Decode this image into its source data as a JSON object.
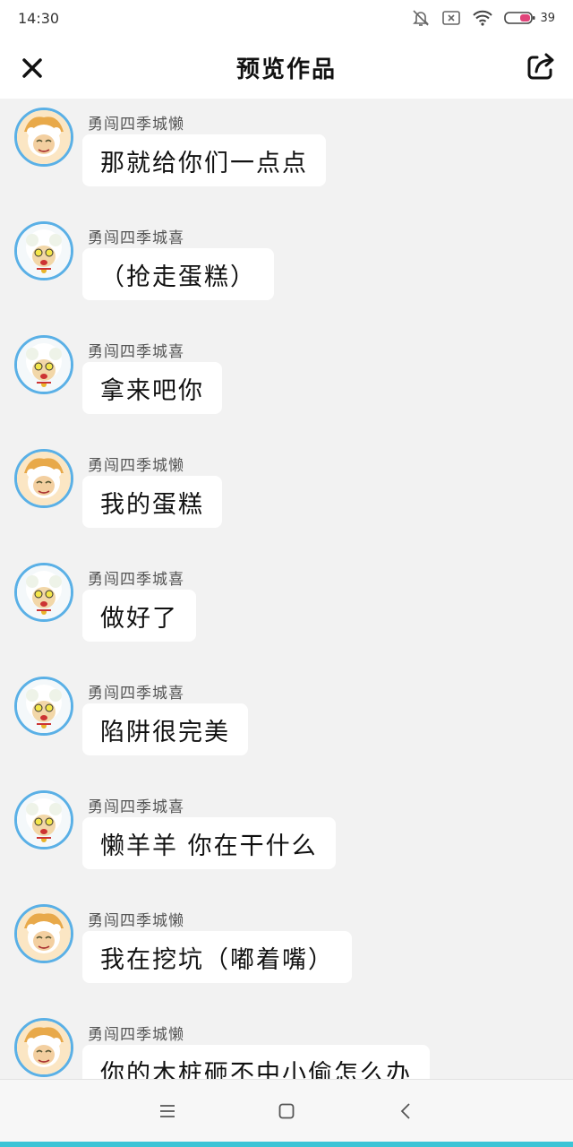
{
  "status_bar": {
    "time": "14:30",
    "battery": "39",
    "icons": [
      "bell-muted-icon",
      "sim-off-icon",
      "wifi-icon",
      "battery-icon"
    ]
  },
  "header": {
    "title": "预览作品",
    "close_icon": "close-icon",
    "share_icon": "share-icon"
  },
  "messages": [
    {
      "sender": "勇闯四季城懒",
      "text": "那就给你们一点点",
      "avatar": "lazy"
    },
    {
      "sender": "勇闯四季城喜",
      "text": "（抢走蛋糕）",
      "avatar": "pleasant"
    },
    {
      "sender": "勇闯四季城喜",
      "text": "拿来吧你",
      "avatar": "pleasant"
    },
    {
      "sender": "勇闯四季城懒",
      "text": "我的蛋糕",
      "avatar": "lazy"
    },
    {
      "sender": "勇闯四季城喜",
      "text": "做好了",
      "avatar": "pleasant"
    },
    {
      "sender": "勇闯四季城喜",
      "text": "陷阱很完美",
      "avatar": "pleasant"
    },
    {
      "sender": "勇闯四季城喜",
      "text": "懒羊羊 你在干什么",
      "avatar": "pleasant"
    },
    {
      "sender": "勇闯四季城懒",
      "text": "我在挖坑（嘟着嘴）",
      "avatar": "lazy"
    },
    {
      "sender": "勇闯四季城懒",
      "text": "你的木桩砸不中小偷怎么办",
      "avatar": "lazy"
    }
  ],
  "bottom_nav": {
    "icons": [
      "menu-icon",
      "home-icon",
      "back-icon"
    ]
  },
  "colors": {
    "accent": "#3bc4d6",
    "avatar_border": "#5ab0e6",
    "background": "#f2f2f2"
  }
}
